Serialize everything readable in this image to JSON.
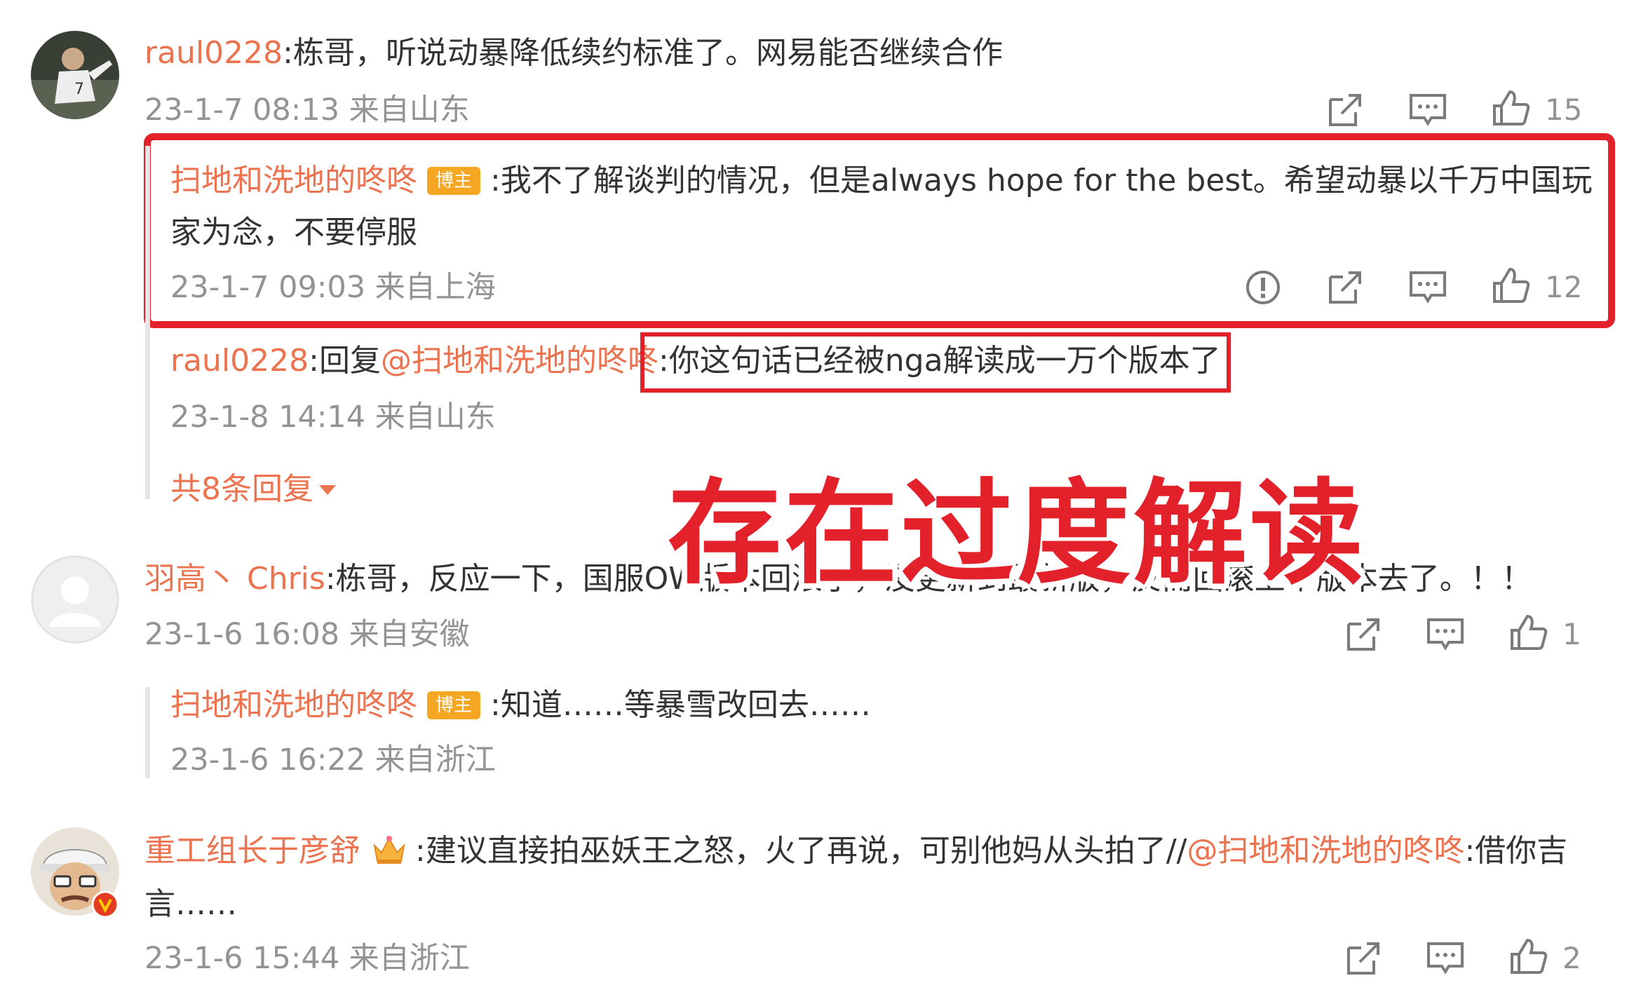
{
  "comments": [
    {
      "username": "raul0228",
      "text": ":栋哥，听说动暴降低续约标准了。网易能否继续合作",
      "meta": "23-1-7 08:13 来自山东",
      "likes": "15",
      "replies": [
        {
          "username": "扫地和洗地的咚咚",
          "badge": "博主",
          "text_line1": ":我不了解谈判的情况，但是always hope for the best。希望动暴以千万中国玩",
          "text_line2": "家为念，不要停服",
          "meta": "23-1-7 09:03 来自上海",
          "likes": "12"
        },
        {
          "username": "raul0228",
          "reply_prefix": ":回复",
          "mention": "@扫地和洗地的咚咚",
          "text": ":你这句话已经被nga解读成一万个版本了",
          "meta": "23-1-8 14:14 来自山东"
        }
      ],
      "more_replies": "共8条回复"
    },
    {
      "username": "羽高丶 Chris",
      "text": ":栋哥，反应一下，国服OW版本回滚了，没更新到最新版，反而回滚上个版本去了。！！",
      "meta": "23-1-6 16:08 来自安徽",
      "likes": "1",
      "replies": [
        {
          "username": "扫地和洗地的咚咚",
          "badge": "博主",
          "text": ":知道……等暴雪改回去……",
          "meta": "23-1-6 16:22 来自浙江"
        }
      ]
    },
    {
      "username": "重工组长于彦舒",
      "text_part1": ":建议直接拍巫妖王之怒，火了再说，可别他妈从头拍了//",
      "mention": "@扫地和洗地的咚咚",
      "text_part2": ":借你吉",
      "text_line2": "言……",
      "meta": "23-1-6 15:44 来自浙江",
      "likes": "2"
    }
  ],
  "overlay_caption": "存在过度解读",
  "colors": {
    "username": "#eb7350",
    "text": "#333333",
    "meta": "#939393",
    "highlight_box": "#e3212b",
    "badge": "#f5a623"
  },
  "icons": [
    "report-icon",
    "share-icon",
    "comment-icon",
    "like-icon",
    "crown-icon",
    "verified-v-icon"
  ]
}
